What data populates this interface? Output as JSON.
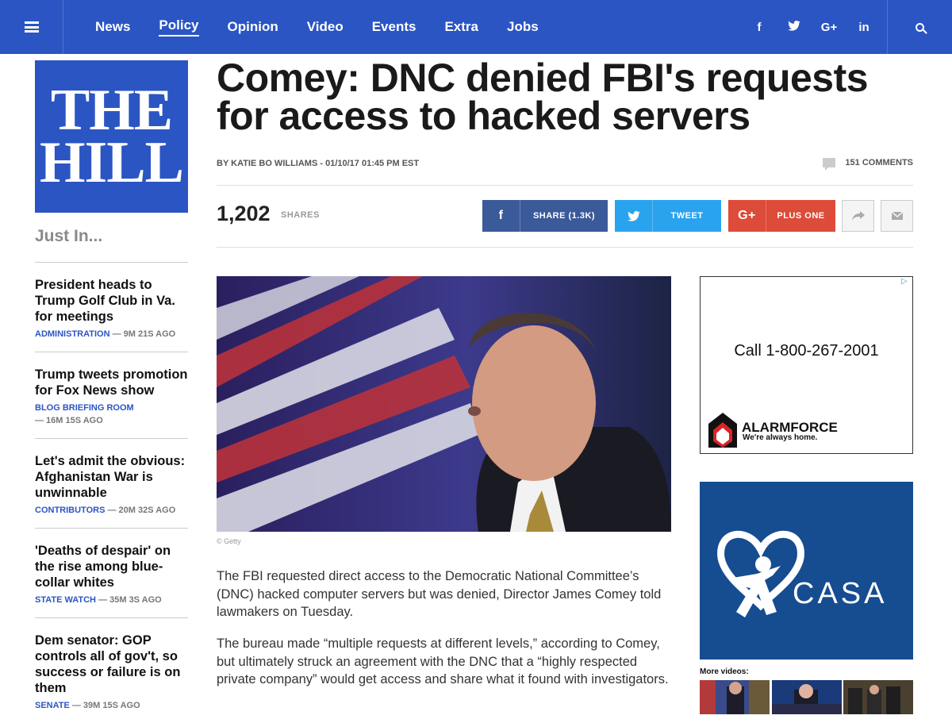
{
  "nav": {
    "items": [
      "News",
      "Policy",
      "Opinion",
      "Video",
      "Events",
      "Extra",
      "Jobs"
    ],
    "active": "Policy",
    "social": [
      "f",
      "t",
      "G+",
      "in"
    ]
  },
  "logo": {
    "line1": "THE",
    "line2": "HILL"
  },
  "sidebar": {
    "heading": "Just In...",
    "items": [
      {
        "headline": "President heads to Trump Golf Club in Va. for meetings",
        "category": "ADMINISTRATION",
        "time": " — 9M 21S AGO"
      },
      {
        "headline": "Trump tweets promotion for Fox News show",
        "category": "BLOG BRIEFING ROOM",
        "time": "— 16M 15S AGO"
      },
      {
        "headline": "Let's admit the obvious: Afghanistan War is unwinnable",
        "category": "CONTRIBUTORS",
        "time": " — 20M 32S AGO"
      },
      {
        "headline": "'Deaths of despair' on the rise among blue-collar whites",
        "category": "STATE WATCH",
        "time": " — 35M 3S AGO"
      },
      {
        "headline": "Dem senator: GOP controls all of gov't, so success or failure is on them",
        "category": "SENATE",
        "time": " — 39M 15S AGO"
      }
    ]
  },
  "article": {
    "title": "Comey: DNC denied FBI's requests for access to hacked servers",
    "byline": "BY KATIE BO WILLIAMS - 01/10/17 01:45 PM EST",
    "comments": "151 COMMENTS",
    "shares_count": "1,202",
    "shares_label": "SHARES",
    "share_buttons": {
      "facebook": "SHARE (1.3K)",
      "twitter": "TWEET",
      "google": "PLUS ONE"
    },
    "image_credit": "© Getty",
    "paragraphs": [
      "The FBI requested direct access to the Democratic National Committee’s (DNC) hacked computer servers but was denied, Director James Comey told lawmakers on Tuesday.",
      "The bureau made “multiple requests at different levels,” according to Comey, but ultimately struck an agreement with the DNC that a “highly respected private company” would get access and share what it found with investigators."
    ]
  },
  "ads": {
    "ad1": {
      "phone": "Call 1-800-267-2001",
      "brand": "ALARMFORCE",
      "tagline": "We're always home."
    },
    "ad2": {
      "brand": "CASA"
    },
    "more_videos": "More videos:"
  },
  "colors": {
    "brand_blue": "#2b55c3",
    "facebook": "#3b5a9a",
    "twitter": "#2aa3ef",
    "google": "#dd4b39"
  }
}
